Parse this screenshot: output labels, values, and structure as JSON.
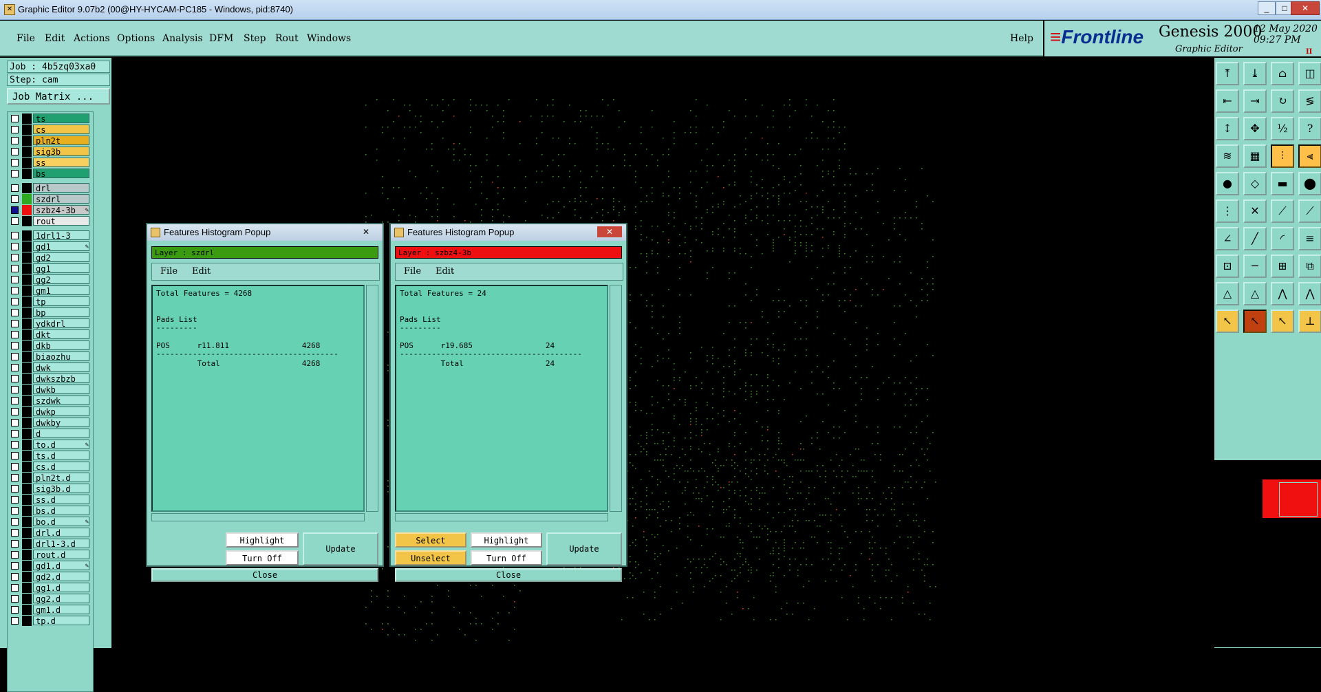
{
  "window": {
    "title": "Graphic Editor 9.07b2 (00@HY-HYCAM-PC185 - Windows, pid:8740)",
    "min_icon": "_",
    "max_icon": "□",
    "close_icon": "✕"
  },
  "menu": {
    "file": "File",
    "edit": "Edit",
    "actions": "Actions",
    "options": "Options",
    "analysis": "Analysis",
    "dfm": "DFM",
    "step": "Step",
    "rout": "Rout",
    "windows": "Windows",
    "help": "Help"
  },
  "brand": {
    "frontline": "Frontline",
    "product": "Genesis 2000",
    "subtitle": "Graphic Editor",
    "date": "12 May 2020",
    "time": "09:27 PM",
    "pause_glyph": "II"
  },
  "left": {
    "job": "Job : 4b5zq03xa0",
    "step": "Step: cam",
    "job_matrix": "Job Matrix ..."
  },
  "layers": [
    {
      "name": "ts",
      "color": "#20a070"
    },
    {
      "name": "cs",
      "color": "#f2c447"
    },
    {
      "name": "pln2t",
      "color": "#e8b020"
    },
    {
      "name": "sig3b",
      "color": "#f2c447"
    },
    {
      "name": "ss",
      "color": "#f8d060"
    },
    {
      "name": "bs",
      "color": "#20a070"
    },
    {
      "name": "drl",
      "color": "#b8c8c8"
    },
    {
      "name": "szdrl",
      "color": "#b8c8c8"
    },
    {
      "name": "szbz4-3b",
      "color": "#c8c8c8"
    },
    {
      "name": "rout",
      "color": "#e8e8e8"
    },
    {
      "name": "1drl1-3"
    },
    {
      "name": "gd1"
    },
    {
      "name": "gd2"
    },
    {
      "name": "gg1"
    },
    {
      "name": "gg2"
    },
    {
      "name": "gm1"
    },
    {
      "name": "tp"
    },
    {
      "name": "bp"
    },
    {
      "name": "ydkdrl"
    },
    {
      "name": "dkt"
    },
    {
      "name": "dkb"
    },
    {
      "name": "biaozhu"
    },
    {
      "name": "dwk"
    },
    {
      "name": "dwkszbzb"
    },
    {
      "name": "dwkb"
    },
    {
      "name": "szdwk"
    },
    {
      "name": "dwkp"
    },
    {
      "name": "dwkby"
    },
    {
      "name": "d"
    },
    {
      "name": "to.d"
    },
    {
      "name": "ts.d"
    },
    {
      "name": "cs.d"
    },
    {
      "name": "pln2t.d"
    },
    {
      "name": "sig3b.d"
    },
    {
      "name": "ss.d"
    },
    {
      "name": "bs.d"
    },
    {
      "name": "bo.d"
    },
    {
      "name": "drl.d"
    },
    {
      "name": "drl1-3.d"
    },
    {
      "name": "rout.d"
    },
    {
      "name": "gd1.d"
    },
    {
      "name": "gd2.d"
    },
    {
      "name": "gg1.d"
    },
    {
      "name": "gg2.d"
    },
    {
      "name": "gm1.d"
    },
    {
      "name": "tp.d"
    }
  ],
  "popup1": {
    "title": "Features Histogram Popup",
    "layer": "Layer :  szdrl",
    "layer_color": "#3a9a10",
    "file": "File",
    "edit": "Edit",
    "total": "Total Features = 4268",
    "pads": "Pads List",
    "dash": "---------",
    "row": "POS      r11.811                4268",
    "sep": "----------------------------------------",
    "total_row": "         Total                  4268",
    "highlight": "Highlight",
    "turn_off": "Turn Off",
    "update": "Update",
    "close": "Close"
  },
  "popup2": {
    "title": "Features Histogram Popup",
    "layer": "Layer :  szbz4-3b",
    "layer_color": "#ee1010",
    "file": "File",
    "edit": "Edit",
    "total": "Total Features = 24",
    "pads": "Pads List",
    "dash": "---------",
    "row": "POS      r19.685                24",
    "sep": "----------------------------------------",
    "total_row": "         Total                  24",
    "select": "Select",
    "unselect": "Unselect",
    "highlight": "Highlight",
    "turn_off": "Turn Off",
    "update": "Update",
    "close": "Close"
  }
}
